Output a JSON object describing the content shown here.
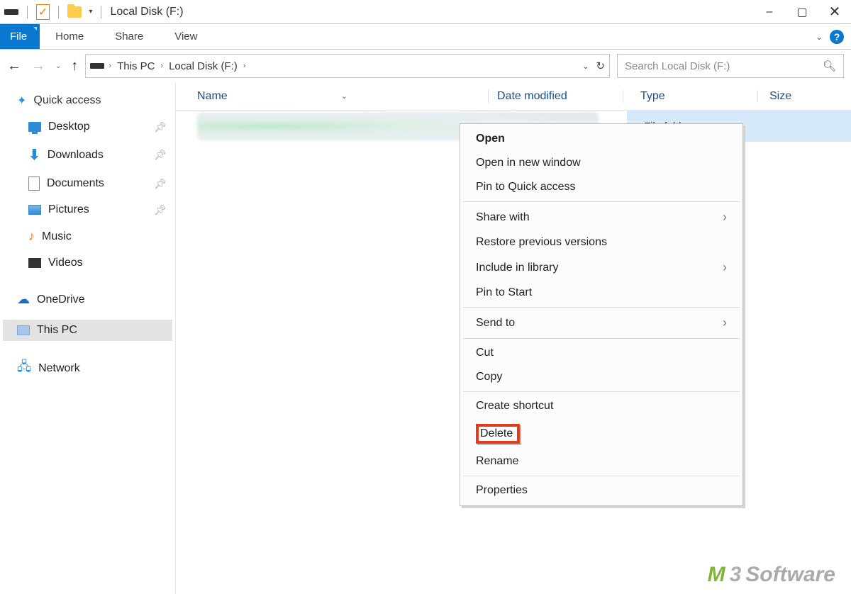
{
  "title": "Local Disk (F:)",
  "window_controls": {
    "minimize": "–",
    "maximize": "▢",
    "close": "✕"
  },
  "ribbon": {
    "file": "File",
    "tabs": [
      "Home",
      "Share",
      "View"
    ]
  },
  "nav": {
    "back": "←",
    "forward": "→",
    "up": "↑",
    "path": [
      "This PC",
      "Local Disk (F:)"
    ]
  },
  "search_placeholder": "Search Local Disk (F:)",
  "sidebar": {
    "quick_access": "Quick access",
    "items": [
      {
        "label": "Desktop",
        "pinned": true
      },
      {
        "label": "Downloads",
        "pinned": true
      },
      {
        "label": "Documents",
        "pinned": true
      },
      {
        "label": "Pictures",
        "pinned": true
      },
      {
        "label": "Music",
        "pinned": false
      },
      {
        "label": "Videos",
        "pinned": false
      }
    ],
    "onedrive": "OneDrive",
    "this_pc": "This PC",
    "network": "Network"
  },
  "columns": {
    "name": "Name",
    "date": "Date modified",
    "type": "Type",
    "size": "Size"
  },
  "row": {
    "type_value": "File folder"
  },
  "context_menu": {
    "open": "Open",
    "open_new_window": "Open in new window",
    "pin_quick": "Pin to Quick access",
    "share_with": "Share with",
    "restore": "Restore previous versions",
    "include_library": "Include in library",
    "pin_start": "Pin to Start",
    "send_to": "Send to",
    "cut": "Cut",
    "copy": "Copy",
    "create_shortcut": "Create shortcut",
    "delete": "Delete",
    "rename": "Rename",
    "properties": "Properties"
  },
  "logo": {
    "m": "M",
    "three": "3",
    "software": "Software"
  }
}
